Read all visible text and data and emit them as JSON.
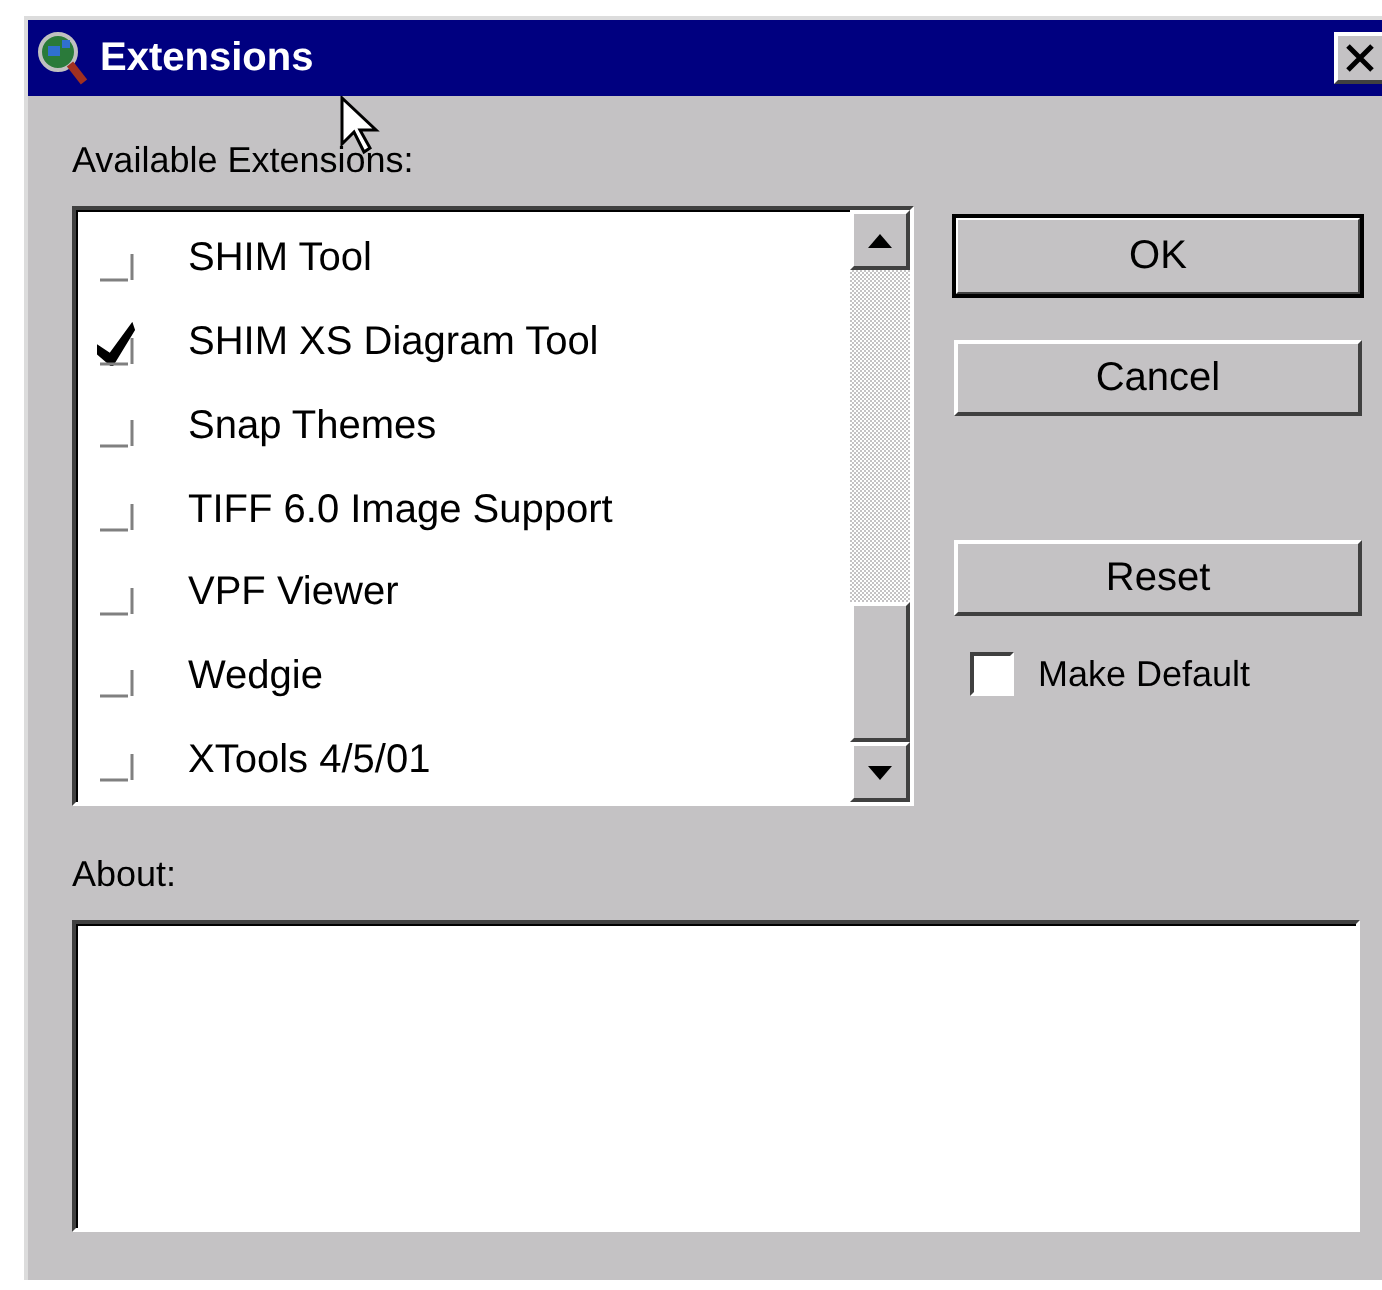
{
  "window": {
    "title": "Extensions"
  },
  "extensions_label": "Available Extensions:",
  "extensions": [
    {
      "name": "SHIM Tool",
      "checked": false
    },
    {
      "name": "SHIM XS Diagram Tool",
      "checked": true
    },
    {
      "name": "Snap Themes",
      "checked": false
    },
    {
      "name": "TIFF 6.0 Image Support",
      "checked": false
    },
    {
      "name": "VPF Viewer",
      "checked": false
    },
    {
      "name": "Wedgie",
      "checked": false
    },
    {
      "name": "XTools 4/5/01",
      "checked": false
    }
  ],
  "buttons": [
    {
      "label": "OK",
      "default": true
    },
    {
      "label": "Cancel",
      "default": false
    },
    {
      "label": "Reset",
      "default": false
    }
  ],
  "make_default": {
    "label": "Make Default",
    "checked": false
  },
  "about_label": "About:"
}
